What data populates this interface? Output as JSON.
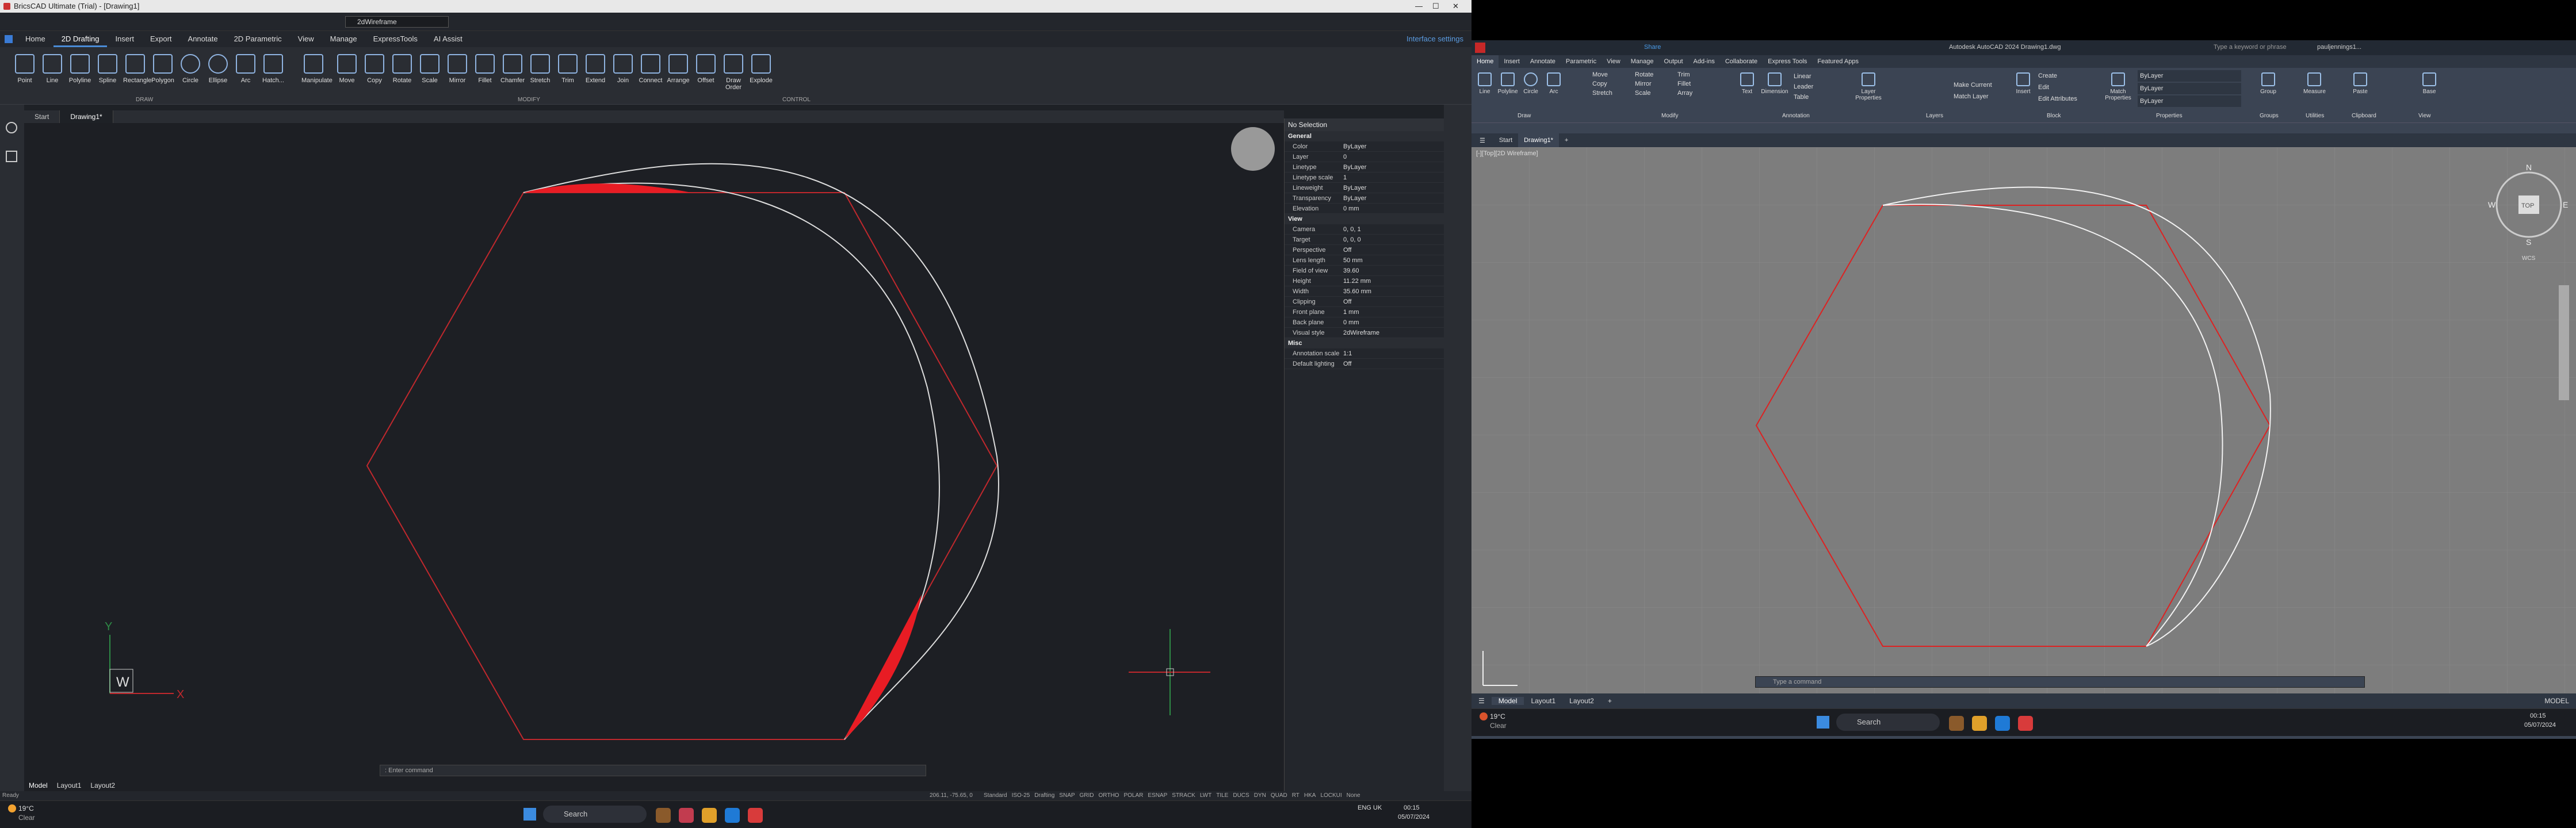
{
  "bricscad": {
    "title": "BricsCAD Ultimate (Trial) - [Drawing1]",
    "visual_style": "2dWireframe",
    "tabs": [
      "Home",
      "2D Drafting",
      "Insert",
      "Export",
      "Annotate",
      "2D Parametric",
      "View",
      "Manage",
      "ExpressTools",
      "AI Assist"
    ],
    "active_tab": "2D Drafting",
    "interface_settings": "Interface settings",
    "ribbon_draw": [
      "Point",
      "Line",
      "Polyline",
      "Spline",
      "Rectangle",
      "Polygon",
      "Circle",
      "Ellipse",
      "Arc",
      "Hatch..."
    ],
    "ribbon_modify": [
      "Manipulate",
      "Move",
      "Copy",
      "Rotate",
      "Scale",
      "Mirror",
      "Fillet",
      "Chamfer",
      "Stretch",
      "Trim",
      "Extend",
      "Join",
      "Connect",
      "Arrange",
      "Offset",
      "Draw Order",
      "Explode"
    ],
    "group_draw": "DRAW",
    "group_modify": "MODIFY",
    "group_control": "CONTROL",
    "doc_tabs": [
      "Start",
      "Drawing1*"
    ],
    "properties": {
      "header": "No Selection",
      "sections": [
        {
          "name": "General",
          "rows": [
            [
              "Color",
              "ByLayer"
            ],
            [
              "Layer",
              "0"
            ],
            [
              "Linetype",
              "ByLayer"
            ],
            [
              "Linetype scale",
              "1"
            ],
            [
              "Lineweight",
              "ByLayer"
            ],
            [
              "Transparency",
              "ByLayer"
            ],
            [
              "Elevation",
              "0 mm"
            ]
          ]
        },
        {
          "name": "View",
          "rows": [
            [
              "Camera",
              "0, 0, 1"
            ],
            [
              "Target",
              "0, 0, 0"
            ],
            [
              "Perspective",
              "Off"
            ],
            [
              "Lens length",
              "50 mm"
            ],
            [
              "Field of view",
              "39.60"
            ],
            [
              "Height",
              "11.22 mm"
            ],
            [
              "Width",
              "35.60 mm"
            ],
            [
              "Clipping",
              "Off"
            ],
            [
              "Front plane",
              "1 mm"
            ],
            [
              "Back plane",
              "0 mm"
            ],
            [
              "Visual style",
              "2dWireframe"
            ]
          ]
        },
        {
          "name": "Misc",
          "rows": [
            [
              "Annotation scale",
              "1:1"
            ],
            [
              "Default lighting",
              "Off"
            ]
          ]
        }
      ]
    },
    "command_prompt": ": Enter command",
    "layout_tabs": [
      "Model",
      "Layout1",
      "Layout2"
    ],
    "status_ready": "Ready",
    "status_coords": "206.11, -75.65, 0",
    "status_items": [
      "Standard",
      "ISO-25",
      "Drafting",
      "SNAP",
      "GRID",
      "ORTHO",
      "POLAR",
      "ESNAP",
      "STRACK",
      "LWT",
      "TILE",
      "DUCS",
      "DYN",
      "QUAD",
      "RT",
      "HKA",
      "LOCKUI",
      "None"
    ],
    "ucs_w": "W",
    "ucs_x": "X",
    "ucs_y": "Y"
  },
  "autocad": {
    "title": "Autodesk AutoCAD 2024   Drawing1.dwg",
    "share": "Share",
    "search_placeholder": "Type a keyword or phrase",
    "user": "pauljennings1...",
    "tabs": [
      "Home",
      "Insert",
      "Annotate",
      "Parametric",
      "View",
      "Manage",
      "Output",
      "Add-ins",
      "Collaborate",
      "Express Tools",
      "Featured Apps"
    ],
    "active_tab": "Home",
    "draw_tools": [
      "Line",
      "Polyline",
      "Circle",
      "Arc"
    ],
    "modify_tools": [
      "Move",
      "Rotate",
      "Trim",
      "Copy",
      "Mirror",
      "Fillet",
      "Stretch",
      "Scale",
      "Array"
    ],
    "annotation_tools": [
      "Text",
      "Dimension",
      "Linear",
      "Leader",
      "Table"
    ],
    "layer_tools": [
      "Layer Properties",
      "Make Current",
      "Match Layer"
    ],
    "block_tools": [
      "Insert",
      "Create",
      "Edit",
      "Edit Attributes"
    ],
    "properties_tools": [
      "Match Properties",
      "ByLayer",
      "ByLayer",
      "ByLayer"
    ],
    "other_tools": [
      "Group",
      "Measure",
      "Paste",
      "Base"
    ],
    "groups": [
      "Draw",
      "Modify",
      "Annotation",
      "Layers",
      "Block",
      "Properties",
      "Groups",
      "Utilities",
      "Clipboard",
      "View"
    ],
    "doc_tabs": [
      "Start",
      "Drawing1*"
    ],
    "viewport_label": "[-][Top][2D Wireframe]",
    "viewcube": {
      "top": "TOP",
      "n": "N",
      "s": "S",
      "e": "E",
      "w": "W",
      "wcs": "WCS"
    },
    "command_prompt": "Type a command",
    "layout_tabs": [
      "Model",
      "Layout1",
      "Layout2"
    ],
    "status_model": "MODEL"
  },
  "taskbar_left": {
    "temp": "19°C",
    "cond": "Clear",
    "search": "Search",
    "lang": "ENG UK",
    "time": "00:15",
    "date": "05/07/2024"
  },
  "taskbar_right": {
    "temp": "19°C",
    "cond": "Clear",
    "search": "Search",
    "time": "00:15",
    "date": "05/07/2024"
  }
}
